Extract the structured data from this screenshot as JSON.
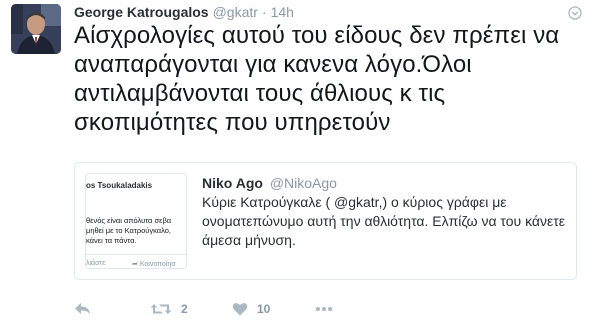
{
  "tweet": {
    "author_name": "George Katrougalos",
    "author_handle": "@gkatr",
    "separator": "·",
    "time": "14h",
    "text": "Αίσχρολογίες αυτού του είδους δεν πρέπει να αναπαράγονται για κανενα λόγο.Όλοι αντιλαμβάνονται τους άθλιους κ τις σκοπιμότητες που υπηρετούν"
  },
  "quoted": {
    "author_name": "Niko Ago",
    "author_handle": "@NikoAgo",
    "text": "Κύριε Κατρούγκαλε ( @gkatr,) ο κύριος γράφει με ονοματεπώνυμο αυτή την αθλιότητα. Ελπίζω να του κάνετε άμεσα μήνυση.",
    "media": {
      "name": "os Tsoukaladakis",
      "line1": "θενός είναι απόλυτα σεβα",
      "line2": "μηθεί με το Κατρούγκαλο,",
      "line3": "κάνει τα πάντα.",
      "action1": "λιάστε",
      "action2": "Κοινοποίησ"
    }
  },
  "actions": {
    "retweet_count": "2",
    "like_count": "10"
  },
  "colors": {
    "text": "#14171a",
    "muted": "#8899a6",
    "icon": "#aab8c2",
    "border": "#e1e8ed"
  },
  "icons": [
    "avatar",
    "caret-down-icon",
    "reply-icon",
    "retweet-icon",
    "heart-icon",
    "more-icon"
  ]
}
